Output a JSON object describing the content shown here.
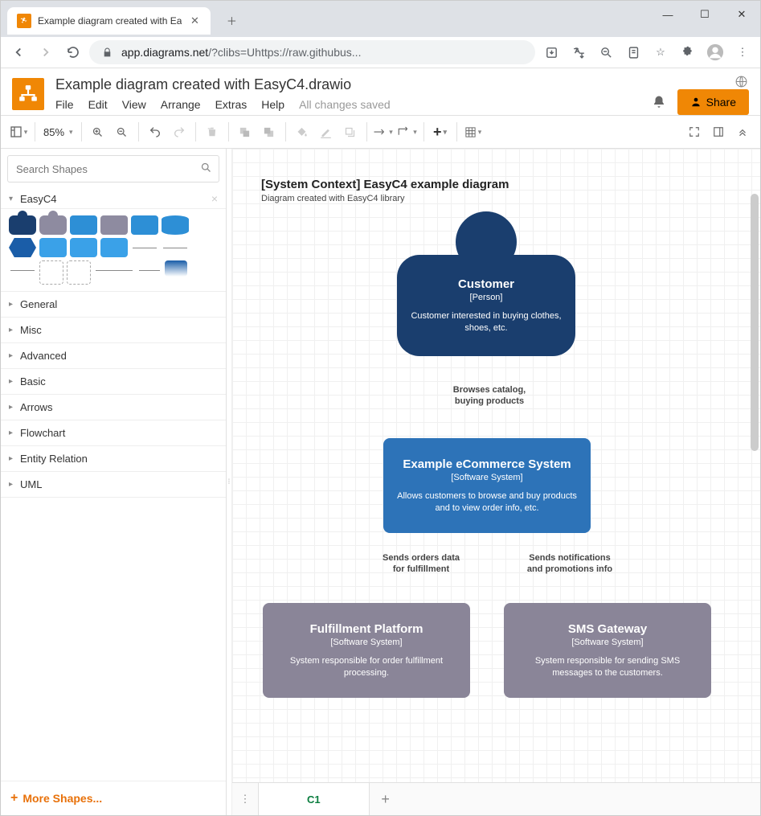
{
  "browser": {
    "tab_title": "Example diagram created with Ea",
    "url_host": "app.diagrams.net",
    "url_path": "/?clibs=Uhttps://raw.githubus..."
  },
  "app": {
    "doc_title": "Example diagram created with EasyC4.drawio",
    "menu": {
      "file": "File",
      "edit": "Edit",
      "view": "View",
      "arrange": "Arrange",
      "extras": "Extras",
      "help": "Help"
    },
    "saved_status": "All changes saved",
    "share_label": "Share",
    "zoom": "85%"
  },
  "sidebar": {
    "search_placeholder": "Search Shapes",
    "library_name": "EasyC4",
    "sections": [
      "General",
      "Misc",
      "Advanced",
      "Basic",
      "Arrows",
      "Flowchart",
      "Entity Relation",
      "UML"
    ],
    "more_shapes": "More Shapes..."
  },
  "diagram": {
    "title": "[System Context] EasyC4 example diagram",
    "subtitle": "Diagram created with EasyC4 library",
    "nodes": {
      "customer": {
        "name": "Customer",
        "type": "[Person]",
        "desc": "Customer interested in buying clothes, shoes, etc."
      },
      "ecommerce": {
        "name": "Example eCommerce System",
        "type": "[Software System]",
        "desc": "Allows customers to browse and buy products and to view order info, etc."
      },
      "fulfillment": {
        "name": "Fulfillment Platform",
        "type": "[Software System]",
        "desc": "System responsible for order fulfillment processing."
      },
      "sms": {
        "name": "SMS Gateway",
        "type": "[Software System]",
        "desc": "System responsible for sending SMS messages to the customers."
      }
    },
    "edges": {
      "e1": "Browses catalog,\nbuying products",
      "e2": "Sends orders data\nfor fulfillment",
      "e3": "Sends notifications\nand promotions info"
    }
  },
  "pages": {
    "active": "C1"
  }
}
